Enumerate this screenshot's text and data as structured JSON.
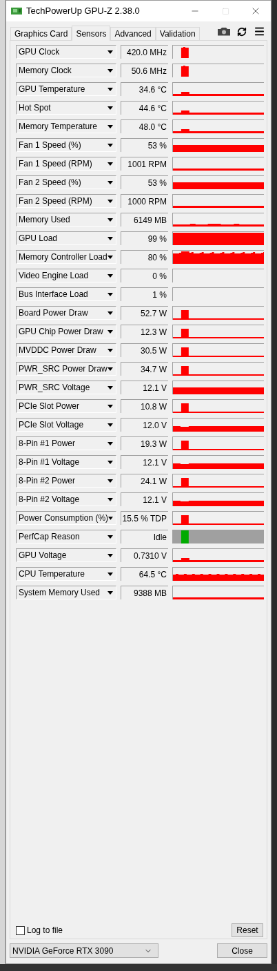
{
  "window": {
    "title": "TechPowerUp GPU-Z 2.38.0"
  },
  "tabs": [
    {
      "label": "Graphics Card",
      "selected": false
    },
    {
      "label": "Sensors",
      "selected": true
    },
    {
      "label": "Advanced",
      "selected": false
    },
    {
      "label": "Validation",
      "selected": false
    }
  ],
  "sensors": [
    {
      "label": "GPU Clock",
      "value": "420.0 MHz"
    },
    {
      "label": "Memory Clock",
      "value": "50.6 MHz"
    },
    {
      "label": "GPU Temperature",
      "value": "34.6 °C"
    },
    {
      "label": "Hot Spot",
      "value": "44.6 °C"
    },
    {
      "label": "Memory Temperature",
      "value": "48.0 °C"
    },
    {
      "label": "Fan 1 Speed (%)",
      "value": "53 %"
    },
    {
      "label": "Fan 1 Speed (RPM)",
      "value": "1001 RPM"
    },
    {
      "label": "Fan 2 Speed (%)",
      "value": "53 %"
    },
    {
      "label": "Fan 2 Speed (RPM)",
      "value": "1000 RPM"
    },
    {
      "label": "Memory Used",
      "value": "6149 MB"
    },
    {
      "label": "GPU Load",
      "value": "99 %"
    },
    {
      "label": "Memory Controller Load",
      "value": "80 %"
    },
    {
      "label": "Video Engine Load",
      "value": "0 %"
    },
    {
      "label": "Bus Interface Load",
      "value": "1 %"
    },
    {
      "label": "Board Power Draw",
      "value": "52.7 W"
    },
    {
      "label": "GPU Chip Power Draw",
      "value": "12.3 W"
    },
    {
      "label": "MVDDC Power Draw",
      "value": "30.5 W"
    },
    {
      "label": "PWR_SRC Power Draw",
      "value": "34.7 W"
    },
    {
      "label": "PWR_SRC Voltage",
      "value": "12.1 V"
    },
    {
      "label": "PCIe Slot Power",
      "value": "10.8 W"
    },
    {
      "label": "PCIe Slot Voltage",
      "value": "12.0 V"
    },
    {
      "label": "8-Pin #1 Power",
      "value": "19.3 W"
    },
    {
      "label": "8-Pin #1 Voltage",
      "value": "12.1 V"
    },
    {
      "label": "8-Pin #2 Power",
      "value": "24.1 W"
    },
    {
      "label": "8-Pin #2 Voltage",
      "value": "12.1 V"
    },
    {
      "label": "Power Consumption (%)",
      "value": "15.5 % TDP"
    },
    {
      "label": "PerfCap Reason",
      "value": "Idle"
    },
    {
      "label": "GPU Voltage",
      "value": "0.7310 V"
    },
    {
      "label": "CPU Temperature",
      "value": "64.5 °C"
    },
    {
      "label": "System Memory Used",
      "value": "9388 MB"
    }
  ],
  "log_to_file": {
    "label": "Log to file",
    "checked": false
  },
  "reset_button": "Reset",
  "gpu_select": {
    "value": "NVIDIA GeForce RTX 3090"
  },
  "close_button": "Close"
}
